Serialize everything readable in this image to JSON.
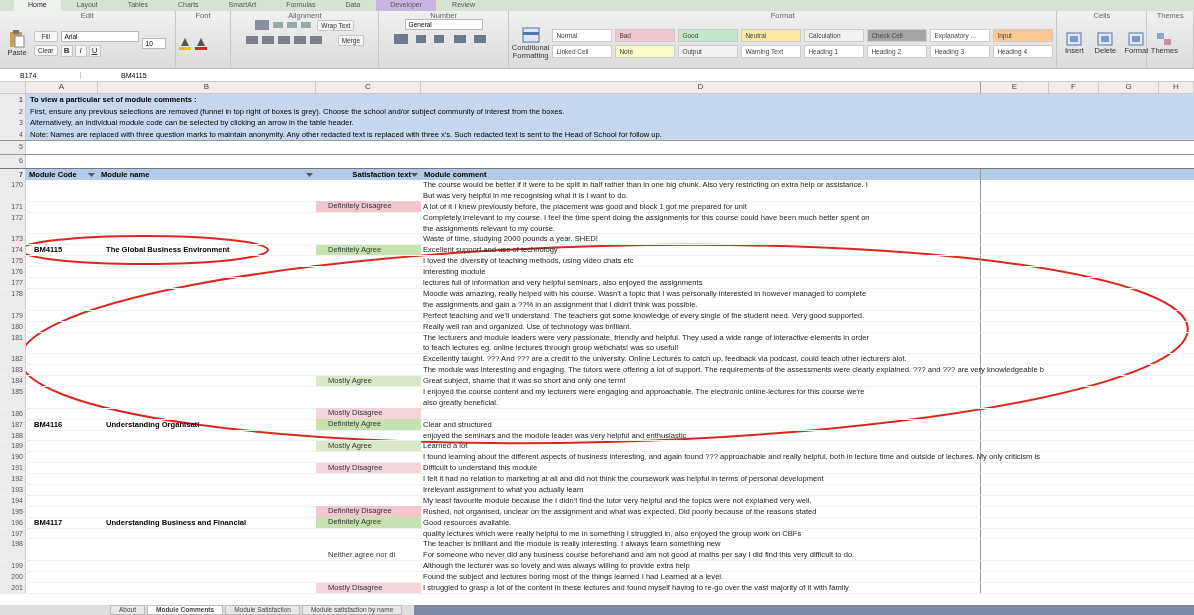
{
  "ribbon_tabs": [
    {
      "label": "Home",
      "selected": true
    },
    {
      "label": "Layout",
      "selected": false
    },
    {
      "label": "Tables",
      "selected": false
    },
    {
      "label": "Charts",
      "selected": false
    },
    {
      "label": "SmartArt",
      "selected": false
    },
    {
      "label": "Formulas",
      "selected": false
    },
    {
      "label": "Data",
      "selected": false
    },
    {
      "label": "Developer",
      "selected": false,
      "color": "#c9b6e0"
    },
    {
      "label": "Review",
      "selected": false
    }
  ],
  "ribbon": {
    "groups": [
      "Edit",
      "Font",
      "Alignment",
      "Number",
      "Format",
      "Cells",
      "Themes"
    ],
    "paste": "Paste",
    "fill": "Fill",
    "clear": "Clear",
    "font_name": "Arial",
    "font_size": "10",
    "format_buttons": [
      "B",
      "I",
      "U"
    ],
    "wrap_text": "Wrap Text",
    "number_format": "General",
    "merge": "Merge",
    "conditional": "Conditional Formatting",
    "styles": [
      {
        "label": "Normal",
        "color": "#ffffff"
      },
      {
        "label": "Bad",
        "color": "#f4c7ce"
      },
      {
        "label": "Good",
        "color": "#c6e7ce"
      },
      {
        "label": "Neutral",
        "color": "#fbeaa3"
      },
      {
        "label": "Calculation",
        "color": "#f2f2f2"
      },
      {
        "label": "Check Cell",
        "color": "#a5a5a5"
      },
      {
        "label": "Explanatory ...",
        "color": "#ffffff"
      },
      {
        "label": "Input",
        "color": "#fbc894"
      },
      {
        "label": "Linked Cell",
        "color": "#ffffff"
      },
      {
        "label": "Note",
        "color": "#fdfbc8"
      },
      {
        "label": "Output",
        "color": "#f2f2f2"
      },
      {
        "label": "Warning Text",
        "color": "#ffffff"
      },
      {
        "label": "Heading 1",
        "color": "#ffffff"
      },
      {
        "label": "Heading 2",
        "color": "#ffffff"
      },
      {
        "label": "Heading 3",
        "color": "#ffffff"
      },
      {
        "label": "Heading 4",
        "color": "#ffffff"
      }
    ],
    "cells_buttons": [
      "Insert",
      "Delete",
      "Format"
    ],
    "themes_buttons": [
      "Themes"
    ]
  },
  "formula_bar": {
    "name_box": "B174",
    "value": "BM4115"
  },
  "columns": [
    "A",
    "B",
    "C",
    "D",
    "E",
    "F",
    "G",
    "H"
  ],
  "intro": [
    {
      "row": "1",
      "text": "To view a particular set of module comments :"
    },
    {
      "row": "2",
      "text": "First, ensure any previous selections are removed (funnel in top right of boxes is grey). Choose the school and/or subject community of interest from the boxes."
    },
    {
      "row": "3",
      "text": "Alternatively, an individual module code can be selected by clicking an arrow in the table header."
    },
    {
      "row": "4",
      "text": "Note: Names are replaced with three question marks to maintain anonymity. Any other redacted text is replaced with three x's. Such redacted text is sent to the Head of School for follow up."
    },
    {
      "row": "5"
    },
    {
      "row": "6"
    }
  ],
  "header": {
    "row": "7",
    "cells": [
      "Module Code",
      "Module name",
      "Satisfaction text",
      "Module comment"
    ]
  },
  "rows": [
    {
      "row": "170",
      "lines": [
        "The course would be better if it were to be split in half rather than in one big chunk. Also very restricting on extra help or assistance. I",
        "But was very helpful in me recognising what it is I want to do."
      ]
    },
    {
      "row": "171",
      "satisfaction": {
        "text": "Definitely Disagree",
        "color": "#f4c7ce"
      },
      "lines": [
        "A lot of it I knew previously before, the placement was good and block 1 got me prepared for unit"
      ]
    },
    {
      "row": "172",
      "lines": [
        "Completely irrelevant to my course. I feel the time spent doing the assignments for this course could have been much better spent on",
        "the assignments relevant to my course."
      ]
    },
    {
      "row": "173",
      "lines": [
        "Waste of time, studying 2000 pounds a year. SHED!"
      ]
    },
    {
      "row": "174",
      "code": "BM4115",
      "name": "The Global Business Environment",
      "satisfaction": {
        "text": "Definitely Agree",
        "color": "#c6e2b0"
      },
      "lines": [
        "Excellent support and use of technology"
      ]
    },
    {
      "row": "175",
      "lines": [
        "I loved the diversity of teaching methods, using video chats etc"
      ]
    },
    {
      "row": "176",
      "lines": [
        "Interesting module"
      ]
    },
    {
      "row": "177",
      "lines": [
        "lectures full of information and very helpful seminars, also enjoyed the assignments"
      ]
    },
    {
      "row": "178",
      "lines": [
        "Moodle was amazing, really helped with his course. Wasn't a topic that I was personally interested in however managed to complete",
        "the assignments and gain a ??% in an assignment that I didn't think was possible."
      ]
    },
    {
      "row": "179",
      "lines": [
        "Perfect teaching and we'll understand. The teachers got some knowledge of every single of the student need. Very good supported."
      ]
    },
    {
      "row": "180",
      "lines": [
        "Really well ran and organized. Use of technology was brilliant."
      ]
    },
    {
      "row": "181",
      "lines": [
        "The lecturers and module leaders were very passionate, friendly and helpful. They used a wide range of interactive elements in order",
        "to teach lectures eg. online lectures through group webchats! was so useful!"
      ]
    },
    {
      "row": "182",
      "lines": [
        "Excellently taught. ??? And ??? are a credit to the university. Online Lectures to catch up, feedback via podcast, could teach other lecturers alot."
      ]
    },
    {
      "row": "183",
      "lines": [
        "The module was interesting and engaging. The tutors were offering a lot of support. The requirements of the assessments were clearly explained. ??? and ??? are very knowledgeable b"
      ]
    },
    {
      "row": "184",
      "satisfaction": {
        "text": "Mostly Agree",
        "color": "#d8e8c8"
      },
      "lines": [
        "Great subject, shame that it was so short and only one term!"
      ]
    },
    {
      "row": "185",
      "lines": [
        "I enjoyed the course content and my lecturers were engaging and approachable. The electronic online-lectures for this course we're",
        "also greatly beneficial."
      ]
    },
    {
      "row": "186",
      "satisfaction": {
        "text": "Mostly Disagree",
        "color": "#f4d5da"
      },
      "lines": []
    },
    {
      "row": "187",
      "code": "BM4116",
      "name": "Understanding Organisati",
      "satisfaction": {
        "text": "Definitely Agree",
        "color": "#c6e2b0"
      },
      "lines": [
        "Clear and structured"
      ]
    },
    {
      "row": "188",
      "lines": [
        "enjoyed the seminars and the module leader was very helpful and enthusiastic"
      ]
    },
    {
      "row": "189",
      "satisfaction": {
        "text": "Mostly Agree",
        "color": "#d8e8c8"
      },
      "lines": [
        "Learned a lot"
      ]
    },
    {
      "row": "190",
      "lines": [
        "I found learning about the different aspects of business interesting, and again found ??? approachable and really helpful, both in lecture time and outside of lectures. My only criticism is"
      ]
    },
    {
      "row": "191",
      "satisfaction": {
        "text": "Mostly Disagree",
        "color": "#f4d5da"
      },
      "lines": [
        "Difficult to understand this module"
      ]
    },
    {
      "row": "192",
      "lines": [
        "I felt it had no relation to marketing at all and did not think the coursework was helpful in terms of personal development"
      ]
    },
    {
      "row": "193",
      "lines": [
        "Irrelevant assignment to what you actually learn"
      ]
    },
    {
      "row": "194",
      "lines": [
        "My least favourite module because the I didn't find the tutor very helpful and the topics were not explained very well."
      ]
    },
    {
      "row": "195",
      "satisfaction": {
        "text": "Definitely Disagree",
        "color": "#f4c7ce"
      },
      "lines": [
        "Rushed, not organised, unclear on the assignment and what was expected. Did poorly because of the reasons stated"
      ]
    },
    {
      "row": "196",
      "code": "BM4117",
      "name": "Understanding Business and Financial",
      "satisfaction": {
        "text": "Definitely Agree",
        "color": "#c6e2b0"
      },
      "lines": [
        "Good resources available."
      ]
    },
    {
      "row": "197",
      "lines": [
        "quality lectures which were really helpful to me in something I struggled in, also enjoyed the group work on CBFs"
      ]
    },
    {
      "row": "198",
      "satisfaction": {
        "text": "Neither agree nor di",
        "color": "#ffffff"
      },
      "lines": [
        "The teacher is brilliant and the module is really interesting. I always learn something new",
        "For someone who never did any business course beforehand and am not good at maths per say I did find this very difficult to do."
      ]
    },
    {
      "row": "199",
      "lines": [
        "Although the lecturer was so lovely and was always willing to provide extra help"
      ]
    },
    {
      "row": "200",
      "lines": [
        "Found the subject and lectures boring most of the things learned I had Learned at a level."
      ]
    },
    {
      "row": "201",
      "satisfaction": {
        "text": "Mostly Disagree",
        "color": "#f4d5da"
      },
      "lines": [
        "I struggled to grasp a lot of the content in these lectures and found myself having to re-go over the vast majority of it with family"
      ]
    }
  ],
  "sheet_tabs": [
    {
      "label": "About",
      "selected": false
    },
    {
      "label": "Module Comments",
      "selected": true
    },
    {
      "label": "Module Satisfaction",
      "selected": false
    },
    {
      "label": "Module satisfaction by name",
      "selected": false
    }
  ]
}
